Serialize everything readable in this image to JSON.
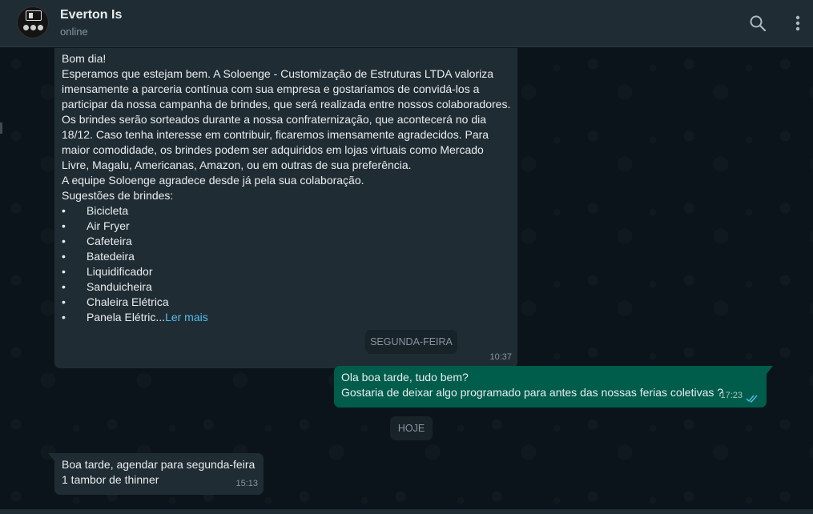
{
  "header": {
    "contact_name": "Everton Is",
    "status": "online",
    "avatar_icon": "company-logo-avatar",
    "search_icon": "search-icon",
    "menu_icon": "more-vertical-icon"
  },
  "messages": [
    {
      "direction": "incoming",
      "lines": [
        "Bom dia!",
        "Esperamos que estejam bem. A Soloenge - Customização de Estruturas LTDA valoriza",
        "imensamente a parceria contínua com sua empresa e gostaríamos de convidá-los a",
        "participar da nossa campanha de brindes, que será realizada entre nossos colaboradores.",
        "Os brindes serão sorteados durante a nossa confraternização, que acontecerá no dia",
        "18/12. Caso tenha interesse em contribuir, ficaremos imensamente agradecidos. Para",
        "maior comodidade, os brindes podem ser adquiridos em lojas virtuais como Mercado",
        "Livre, Magalu, Americanas, Amazon, ou em outras de sua preferência.",
        "A equipe Soloenge agradece desde já pela sua colaboração.",
        "Sugestões de brindes:"
      ],
      "bullet_symbol": "•",
      "bullets": [
        "Bicicleta",
        "Air Fryer",
        "Cafeteira",
        "Batedeira",
        "Liquidificador",
        "Sanduicheira",
        "Chaleira Elétrica",
        "Panela Elétric..."
      ],
      "read_more": "Ler mais",
      "time": "10:37"
    },
    {
      "direction": "outgoing",
      "lines": [
        "Ola boa tarde, tudo bem?",
        "Gostaria de deixar algo programado para antes das nossas ferias coletivas ?"
      ],
      "time": "17:23",
      "status_icon": "double-check-read-icon"
    },
    {
      "direction": "incoming",
      "lines": [
        "Boa tarde, agendar para segunda-feira",
        "1 tambor de thinner"
      ],
      "time": "15:13"
    }
  ],
  "date_separators": [
    "SEGUNDA-FEIRA",
    "HOJE"
  ],
  "colors": {
    "background": "#0b141a",
    "header": "#202c33",
    "incoming_bubble": "#202c33",
    "outgoing_bubble": "#005c4b",
    "link": "#53bdeb",
    "read_ticks": "#53bdeb"
  }
}
